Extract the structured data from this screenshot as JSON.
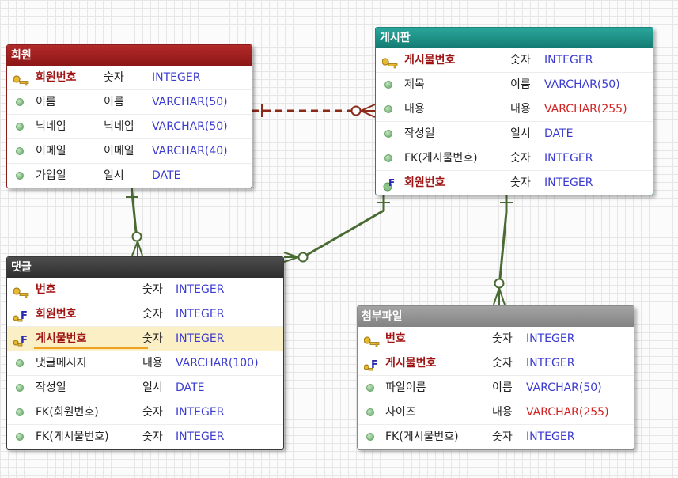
{
  "colors": {
    "relation_line": "#4a6a33",
    "identifying_line": "#8c2a1a",
    "pk_name": "#a01414",
    "type_blue": "#3b3bd0",
    "type_red": "#d32222"
  },
  "entities": {
    "member": {
      "title": "회원",
      "rows": [
        {
          "name": "회원번호",
          "logical": "숫자",
          "type": "INTEGER",
          "kind": "pk",
          "icon": "key-icon"
        },
        {
          "name": "이름",
          "logical": "이름",
          "type": "VARCHAR(50)",
          "kind": "attr",
          "icon": "attribute-dot-icon"
        },
        {
          "name": "닉네임",
          "logical": "닉네임",
          "type": "VARCHAR(50)",
          "kind": "attr",
          "icon": "attribute-dot-icon"
        },
        {
          "name": "이메일",
          "logical": "이메일",
          "type": "VARCHAR(40)",
          "kind": "attr",
          "icon": "attribute-dot-icon"
        },
        {
          "name": "가입일",
          "logical": "일시",
          "type": "DATE",
          "kind": "attr",
          "icon": "attribute-dot-icon"
        }
      ]
    },
    "board": {
      "title": "게시판",
      "rows": [
        {
          "name": "게시물번호",
          "logical": "숫자",
          "type": "INTEGER",
          "kind": "pk",
          "icon": "key-icon"
        },
        {
          "name": "제목",
          "logical": "이름",
          "type": "VARCHAR(50)",
          "kind": "attr",
          "icon": "attribute-dot-icon"
        },
        {
          "name": "내용",
          "logical": "내용",
          "type": "VARCHAR(255)",
          "kind": "attr",
          "icon": "attribute-dot-icon"
        },
        {
          "name": "작성일",
          "logical": "일시",
          "type": "DATE",
          "kind": "attr",
          "icon": "attribute-dot-icon"
        },
        {
          "name": "FK(게시물번호)",
          "logical": "숫자",
          "type": "INTEGER",
          "kind": "attr",
          "icon": "attribute-dot-icon"
        },
        {
          "name": "회원번호",
          "logical": "숫자",
          "type": "INTEGER",
          "kind": "fk",
          "icon": "foreign-key-dot-icon"
        }
      ]
    },
    "comment": {
      "title": "댓글",
      "rows": [
        {
          "name": "번호",
          "logical": "숫자",
          "type": "INTEGER",
          "kind": "pk",
          "icon": "key-icon"
        },
        {
          "name": "회원번호",
          "logical": "숫자",
          "type": "INTEGER",
          "kind": "pkfk",
          "icon": "primary-foreign-key-icon"
        },
        {
          "name": "게시물번호",
          "logical": "숫자",
          "type": "INTEGER",
          "kind": "pkfk",
          "icon": "primary-foreign-key-icon",
          "selected": true
        },
        {
          "name": "댓글메시지",
          "logical": "내용",
          "type": "VARCHAR(100)",
          "kind": "attr",
          "icon": "attribute-dot-icon"
        },
        {
          "name": "작성일",
          "logical": "일시",
          "type": "DATE",
          "kind": "attr",
          "icon": "attribute-dot-icon"
        },
        {
          "name": "FK(회원번호)",
          "logical": "숫자",
          "type": "INTEGER",
          "kind": "attr",
          "icon": "attribute-dot-icon"
        },
        {
          "name": "FK(게시물번호)",
          "logical": "숫자",
          "type": "INTEGER",
          "kind": "attr",
          "icon": "attribute-dot-icon"
        }
      ]
    },
    "attachment": {
      "title": "첨부파일",
      "rows": [
        {
          "name": "번호",
          "logical": "숫자",
          "type": "INTEGER",
          "kind": "pk",
          "icon": "key-icon"
        },
        {
          "name": "게시물번호",
          "logical": "숫자",
          "type": "INTEGER",
          "kind": "pkfk",
          "icon": "primary-foreign-key-icon"
        },
        {
          "name": "파일이름",
          "logical": "이름",
          "type": "VARCHAR(50)",
          "kind": "attr",
          "icon": "attribute-dot-icon"
        },
        {
          "name": "사이즈",
          "logical": "내용",
          "type": "VARCHAR(255)",
          "kind": "attr",
          "icon": "attribute-dot-icon"
        },
        {
          "name": "FK(게시물번호)",
          "logical": "숫자",
          "type": "INTEGER",
          "kind": "attr",
          "icon": "attribute-dot-icon"
        }
      ]
    }
  },
  "relationships": [
    {
      "from": "member",
      "to": "board",
      "style": "dashed",
      "cardinality": "one-to-zero-or-many"
    },
    {
      "from": "member",
      "to": "comment",
      "style": "solid",
      "cardinality": "one-to-zero-or-many"
    },
    {
      "from": "board",
      "to": "comment",
      "style": "solid",
      "cardinality": "one-to-zero-or-many"
    },
    {
      "from": "board",
      "to": "attachment",
      "style": "solid",
      "cardinality": "one-to-zero-or-many"
    }
  ]
}
